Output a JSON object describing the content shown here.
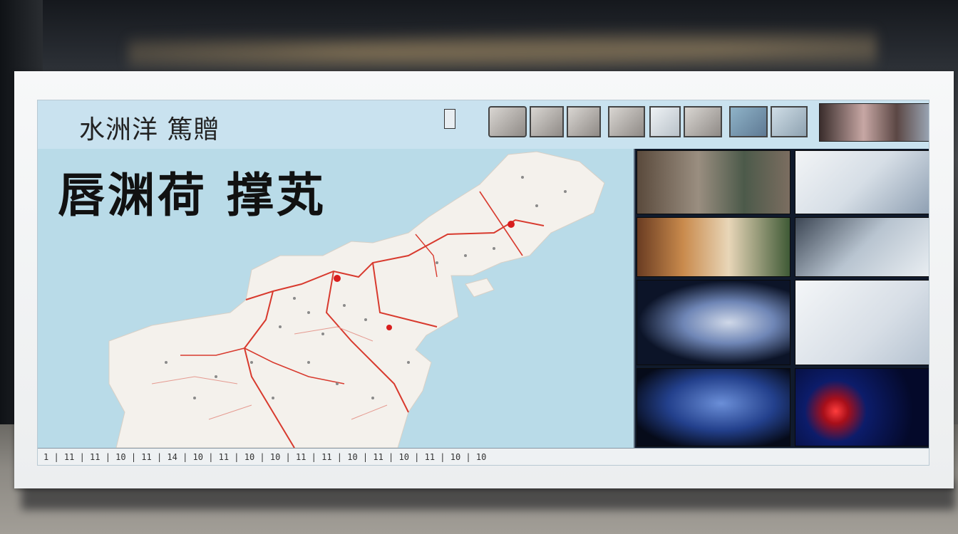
{
  "scene": {
    "header_title": "水洲洋 篤贈",
    "map_title": "唇渊荷 撑芄",
    "ticker_text": "1 | 11 | 11 | 10 | 11 | 14 | 10 | 11 | 10 | 10 | 11 | 11 | 10 | 11 | 10 | 11 | 10 | 10"
  },
  "colors": {
    "screen_bg": "#cfe3ee",
    "map_sea": "#b9dbe8",
    "land": "#f4f1ec",
    "border_red": "#d83a2e",
    "marker_red": "#d81e1e"
  },
  "gallery": {
    "photos": [
      {
        "name": "market-workers-photo"
      },
      {
        "name": "masked-worker-photo"
      },
      {
        "name": "shop-interior-photo"
      },
      {
        "name": "protective-suits-photo"
      },
      {
        "name": "hooded-face-photo"
      },
      {
        "name": "two-masked-people-photo"
      },
      {
        "name": "blue-blur-photo"
      },
      {
        "name": "virus-illustration-photo"
      }
    ]
  }
}
